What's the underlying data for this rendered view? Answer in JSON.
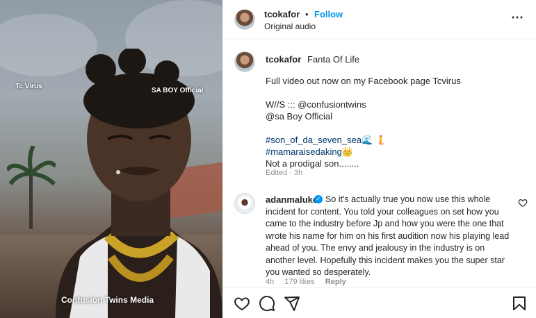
{
  "media": {
    "watermark_tl": "Tc Virus",
    "watermark_tr": "SA BOY Official",
    "watermark_bottom": "Confusion Twins Media"
  },
  "header": {
    "username": "tcokafor",
    "separator": "•",
    "follow_label": "Follow",
    "audio_label": "Original audio",
    "more_icon": "more-horizontal-icon"
  },
  "caption": {
    "username": "tcokafor",
    "title": "Fanta Of Life",
    "lines": [
      "Full video out now on my Facebook page Tcvirus",
      "",
      "W//S ::: @confusiontwins",
      "@sa Boy Official",
      "",
      "#son_of_da_seven_sea🌊 🧜",
      "#mamaraisedaking👑",
      "Not a prodigal son........"
    ],
    "edited": "Edited · 3h"
  },
  "comment": {
    "username": "adanmaluke",
    "verified_icon": "verified-badge-icon",
    "text": "So it's actually true you now use this whole incident for content. You told your colleagues on set how you came to the industry before Jp and how you were the one that wrote his name for him on his first audition now his playing lead ahead of you. The envy and jealousy in the industry is on another level. Hopefully this incident makes you the super star you wanted so desperately.",
    "time": "4h",
    "likes": "179 likes",
    "reply_label": "Reply"
  },
  "actions": {
    "like_icon": "heart-icon",
    "comment_icon": "comment-icon",
    "share_icon": "share-icon",
    "save_icon": "bookmark-icon"
  },
  "colors": {
    "accent": "#0095f6",
    "link": "#00376b",
    "muted": "#8e8e8e",
    "text": "#262626"
  }
}
